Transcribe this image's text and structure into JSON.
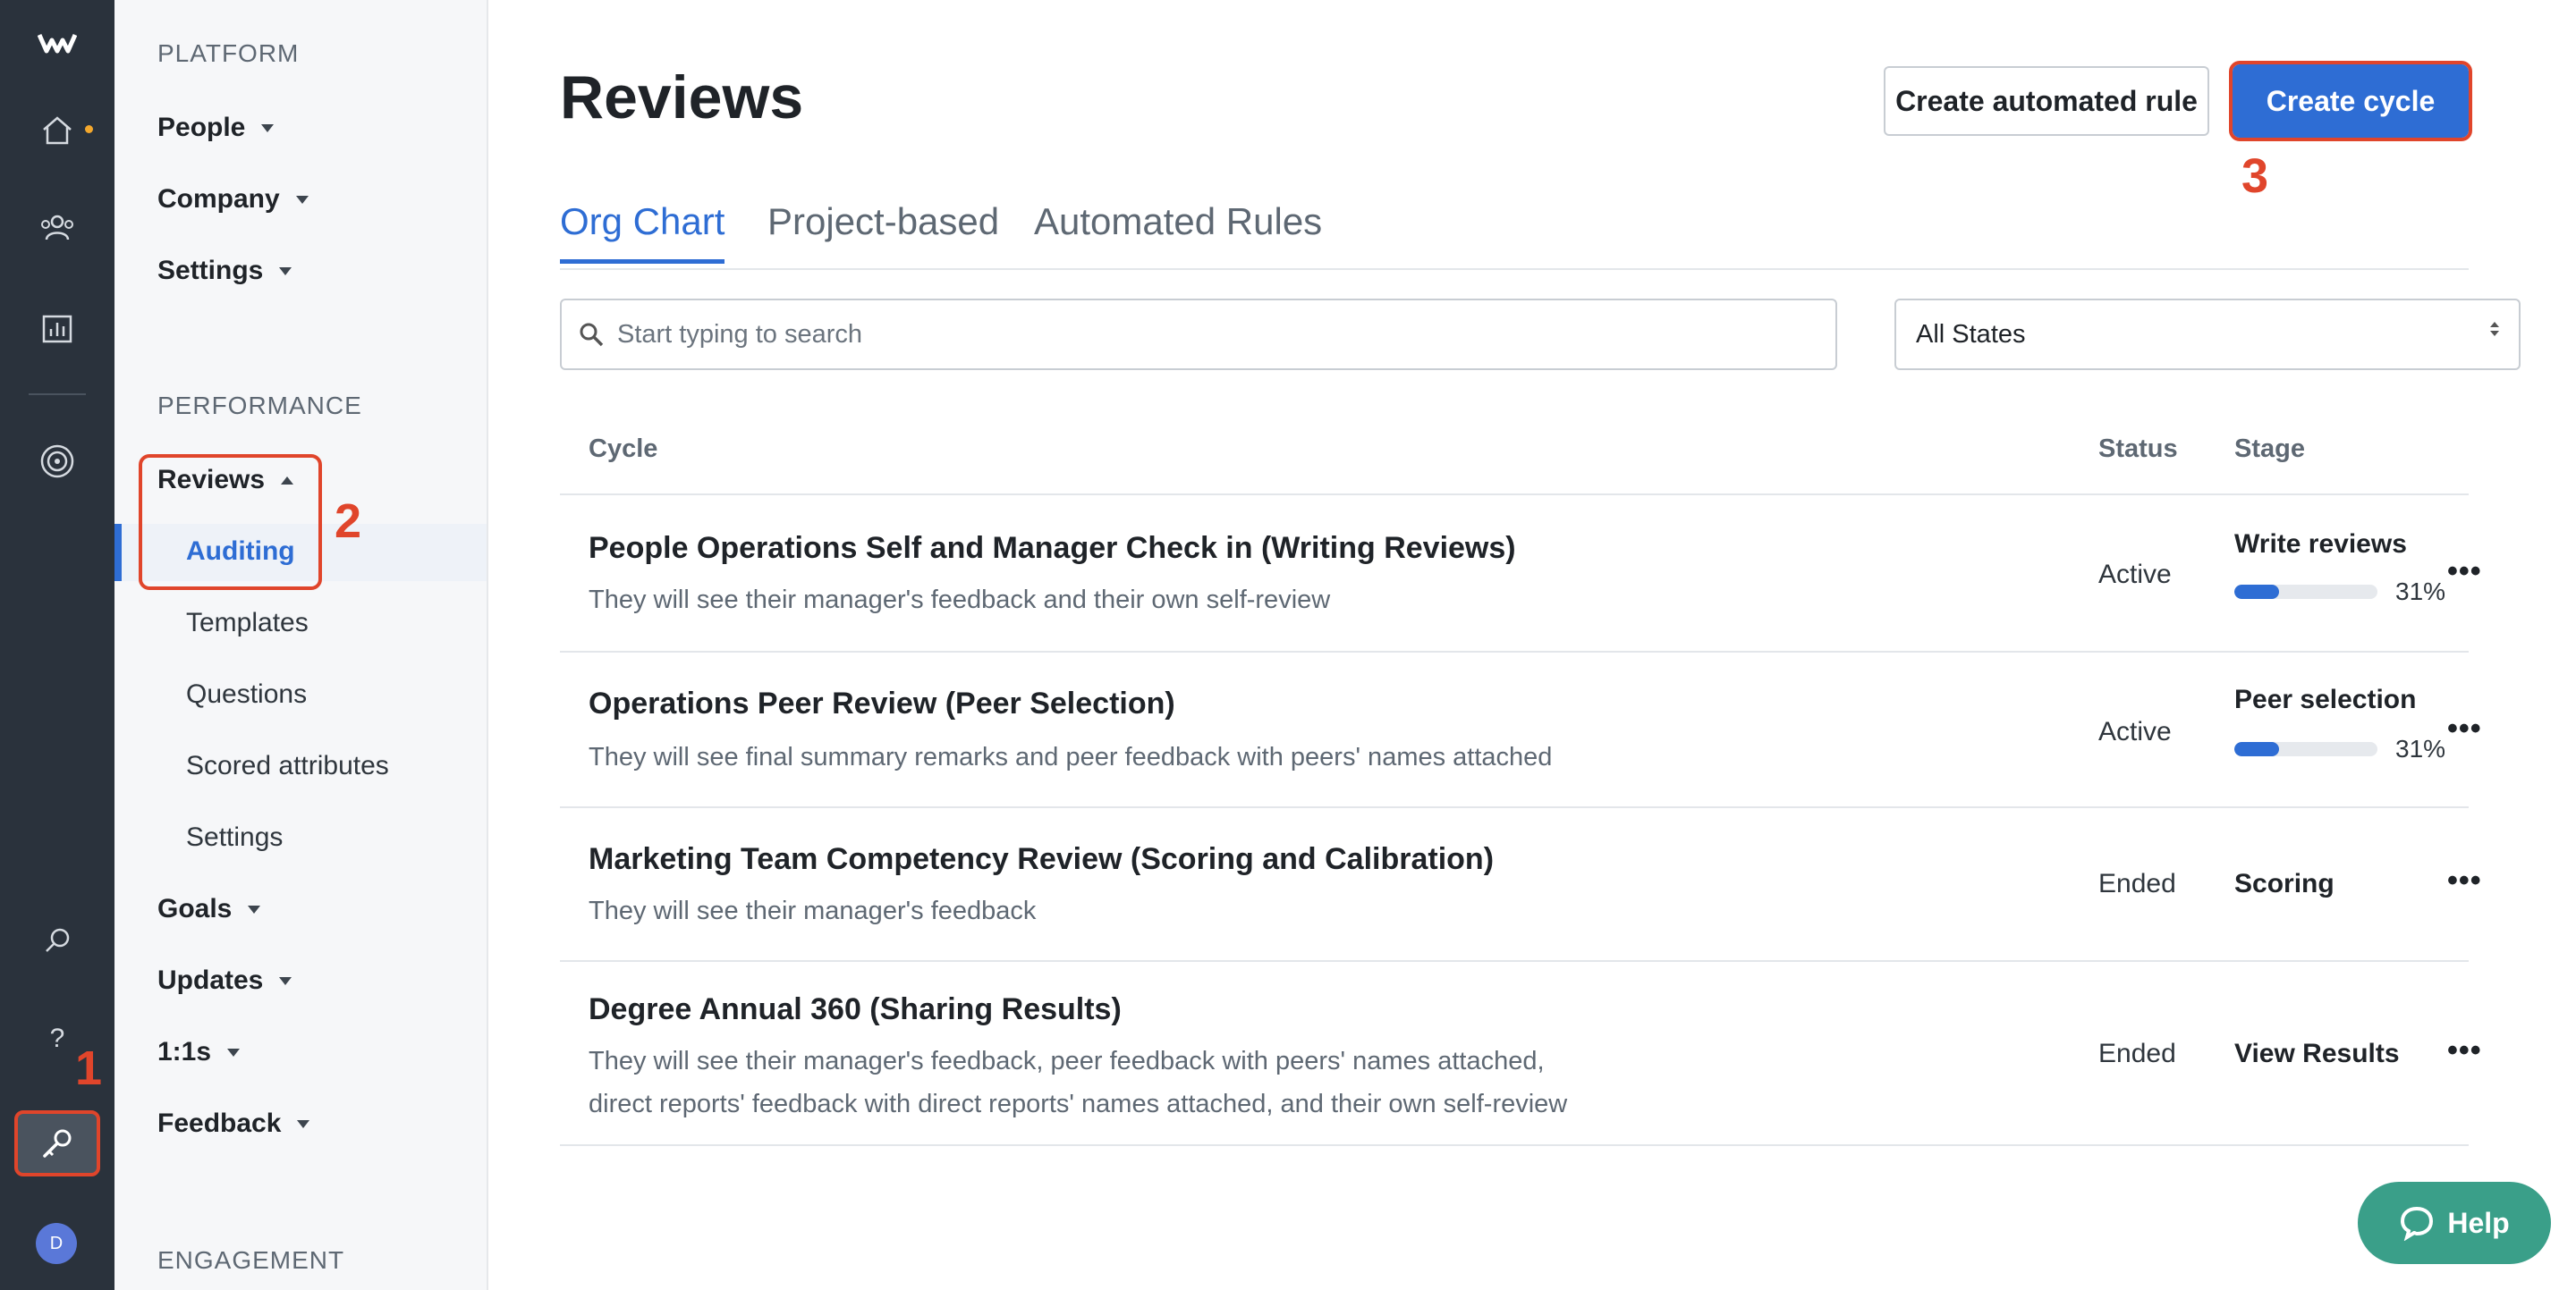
{
  "rail": {
    "icons": [
      "logo-icon",
      "home-icon",
      "people-icon",
      "analytics-icon",
      "target-icon",
      "search-icon",
      "help-question-icon",
      "admin-wrench-icon"
    ],
    "avatar_initial": "D",
    "annotation": "1"
  },
  "sidenav": {
    "sections": {
      "platform": "PLATFORM",
      "performance": "PERFORMANCE",
      "engagement": "ENGAGEMENT"
    },
    "platform_items": [
      "People",
      "Company",
      "Settings"
    ],
    "reviews_label": "Reviews",
    "reviews_sub": [
      "Auditing",
      "Templates",
      "Questions",
      "Scored attributes",
      "Settings"
    ],
    "performance_items": [
      "Goals",
      "Updates",
      "1:1s",
      "Feedback"
    ],
    "annotation": "2"
  },
  "header": {
    "title": "Reviews",
    "automated_rule_button": "Create automated rule",
    "create_cycle_button": "Create cycle",
    "annotation": "3"
  },
  "tabs": [
    "Org Chart",
    "Project-based",
    "Automated Rules"
  ],
  "filters": {
    "search_placeholder": "Start typing to search",
    "state_select": "All States"
  },
  "table": {
    "columns": [
      "Cycle",
      "Status",
      "Stage"
    ],
    "rows": [
      {
        "title": "People Operations Self and Manager Check in (Writing Reviews)",
        "desc": "They will see their manager's feedback and their own self-review",
        "desc2": "",
        "status": "Active",
        "stage": "Write reviews",
        "progress": 0.31,
        "progress_label": "31%"
      },
      {
        "title": "Operations Peer Review (Peer Selection)",
        "desc": "They will see final summary remarks and peer feedback with peers' names attached",
        "desc2": "",
        "status": "Active",
        "stage": "Peer selection",
        "progress": 0.31,
        "progress_label": "31%"
      },
      {
        "title": "Marketing Team Competency Review (Scoring and Calibration)",
        "desc": "They will see their manager's feedback",
        "desc2": "",
        "status": "Ended",
        "stage": "Scoring"
      },
      {
        "title": "Degree Annual 360 (Sharing Results)",
        "desc": "They will see their manager's feedback, peer feedback with peers' names attached,",
        "desc2": "direct reports' feedback with direct reports' names attached, and their own self-review",
        "status": "Ended",
        "stage": "View Results"
      }
    ],
    "more_label": "•••"
  },
  "help": {
    "label": "Help"
  },
  "colors": {
    "accent": "#2e6dd4",
    "annotation": "#e0452b",
    "help": "#3a9f89",
    "rail": "#2a323c"
  }
}
